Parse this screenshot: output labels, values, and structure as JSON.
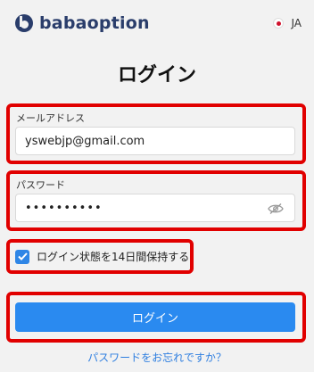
{
  "header": {
    "brand": "babaoption",
    "language": "JA"
  },
  "login": {
    "title": "ログイン",
    "email_label": "メールアドレス",
    "email_value": "yswebjp@gmail.com",
    "password_label": "パスワード",
    "password_value": "••••••••••",
    "remember_label": "ログイン状態を14日間保持する",
    "remember_checked": true,
    "submit_label": "ログイン",
    "forgot_link": "パスワードをお忘れですか？"
  },
  "colors": {
    "highlight_border": "#e10000",
    "primary_button": "#2a8af0",
    "brand": "#2a3d6b"
  },
  "icons": [
    "logo-mark-icon",
    "flag-icon",
    "eye-slash-icon",
    "checkmark-icon"
  ]
}
